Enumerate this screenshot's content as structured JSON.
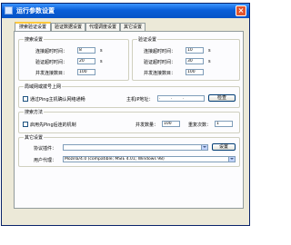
{
  "window": {
    "title": "运行参数设置",
    "close_glyph": "×"
  },
  "tabs": [
    "搜索验证设置",
    "验证数据设置",
    "代理调度设置",
    "其它设置"
  ],
  "search": {
    "title": "搜索设置",
    "connect_timeout_label": "连接超时时间：",
    "connect_timeout": "8",
    "verify_timeout_label": "验证超时时间：",
    "verify_timeout": "20",
    "concurrency_label": "并发连接数目：",
    "concurrency": "100",
    "unit": "s"
  },
  "verify": {
    "title": "验证设置",
    "connect_timeout_label": "连接超时时间：",
    "connect_timeout": "10",
    "verify_timeout_label": "验证超时时间：",
    "verify_timeout": "30",
    "concurrency_label": "并发连接数目：",
    "concurrency": "100",
    "unit": "s"
  },
  "lan": {
    "title": "局域网或拨号上网",
    "ping_label": "通过Ping主机确认网络通畅",
    "host_label": "主机IP地址：",
    "host_ip": ". . .",
    "check_button": "检查"
  },
  "method": {
    "title": "搜索方法",
    "ping_filter_label": "启用先Ping后连的机制",
    "packets_label": "并发数量：",
    "packets": "100",
    "retries_label": "重复次数：",
    "retries": "1"
  },
  "other": {
    "title": "其它设置",
    "plugin_label": "协议插件：",
    "plugin_button": "设置",
    "agent_label": "用户代理：",
    "agent_value": "Mozilla/4.0 (compatible; MSIE 4.01; Windows 98)"
  }
}
